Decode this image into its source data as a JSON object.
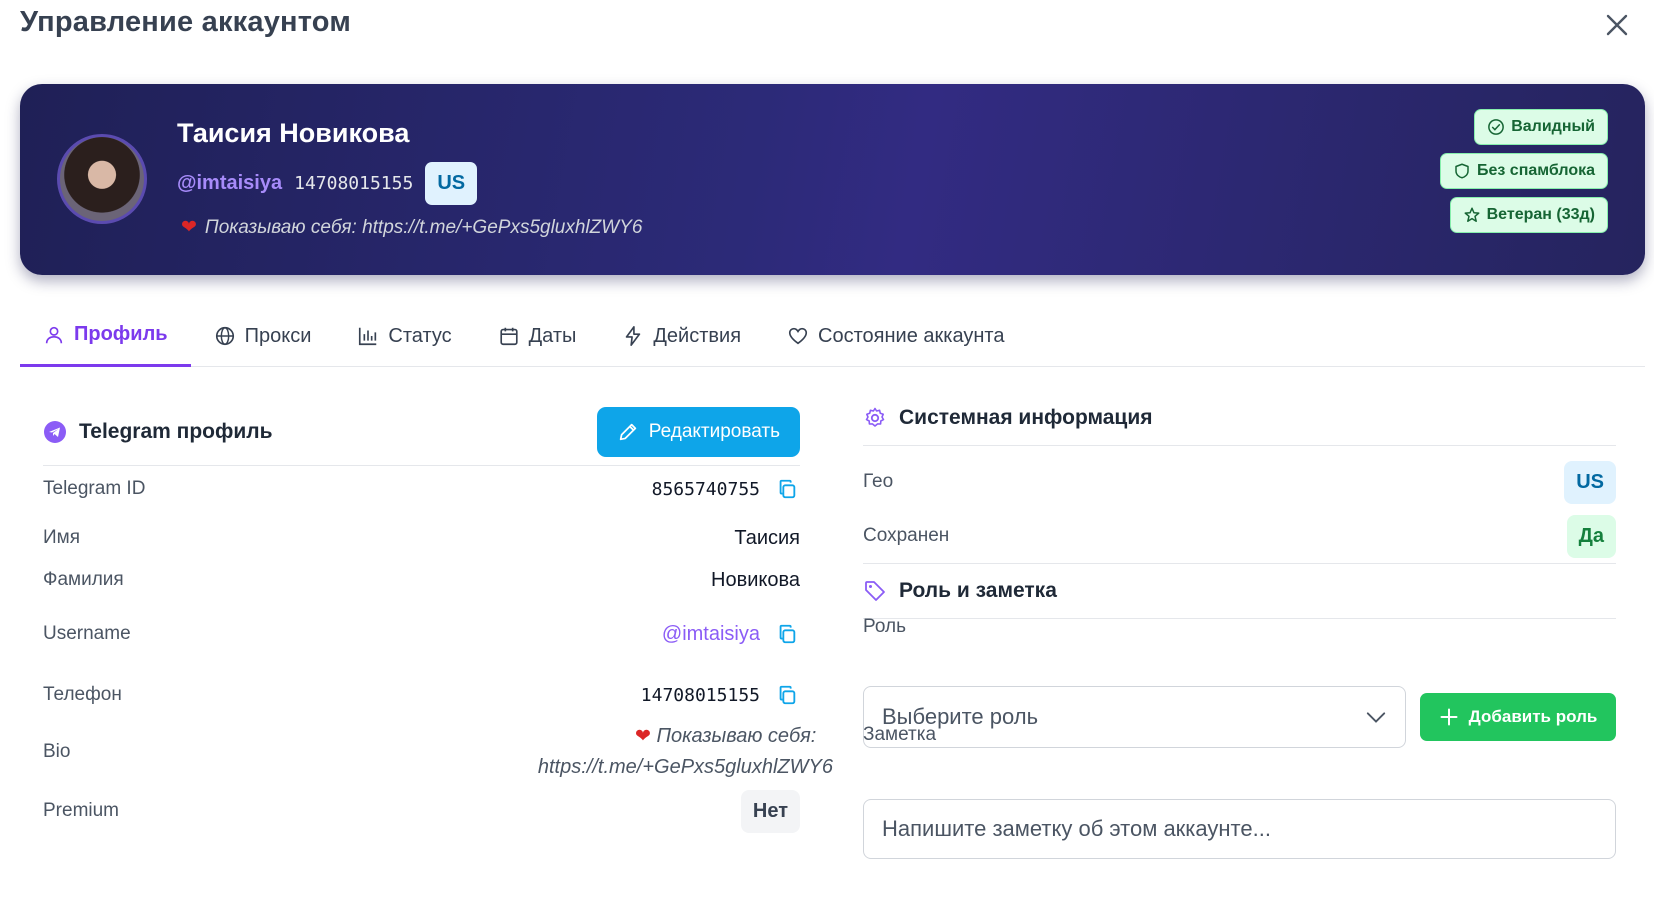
{
  "modal": {
    "title": "Управление аккаунтом"
  },
  "hero": {
    "name": "Таисия Новикова",
    "username": "@imtaisiya",
    "phone": "14708015155",
    "geo": "US",
    "bio": "Показываю себя: https://t.me/+GePxs5gluxhlZWY6",
    "badges": {
      "valid": "Валидный",
      "no_spamblock": "Без спамблока",
      "veteran": "Ветеран (33д)"
    }
  },
  "tabs": [
    {
      "label": "Профиль",
      "icon": "user-icon",
      "active": true
    },
    {
      "label": "Прокси",
      "icon": "globe-icon"
    },
    {
      "label": "Статус",
      "icon": "bar-chart-icon"
    },
    {
      "label": "Даты",
      "icon": "calendar-icon"
    },
    {
      "label": "Действия",
      "icon": "lightning-icon"
    },
    {
      "label": "Состояние аккаунта",
      "icon": "heart-icon"
    }
  ],
  "telegram_profile": {
    "title": "Telegram профиль",
    "edit_label": "Редактировать",
    "fields": {
      "telegram_id": {
        "label": "Telegram ID",
        "value": "8565740755"
      },
      "first_name": {
        "label": "Имя",
        "value": "Таисия"
      },
      "last_name": {
        "label": "Фамилия",
        "value": "Новикова"
      },
      "username": {
        "label": "Username",
        "value": "@imtaisiya"
      },
      "phone": {
        "label": "Телефон",
        "value": "14708015155"
      },
      "bio": {
        "label": "Bio",
        "line1": "Показываю себя:",
        "line2": "https://t.me/+GePxs5gluxhlZWY6"
      },
      "premium": {
        "label": "Premium",
        "value": "Нет"
      }
    }
  },
  "system_info": {
    "title": "Системная информация",
    "geo": {
      "label": "Гео",
      "value": "US"
    },
    "saved": {
      "label": "Сохранен",
      "value": "Да"
    }
  },
  "role_note": {
    "title": "Роль и заметка",
    "role_label": "Роль",
    "role_placeholder": "Выберите роль",
    "add_role_label": "Добавить роль",
    "note_label": "Заметка",
    "note_placeholder": "Напишите заметку об этом аккаунте..."
  },
  "colors": {
    "accent": "#7c3aed",
    "edit_button": "#0ea5e9",
    "add_button": "#22c55e",
    "hero_bg": "#2c2a78"
  }
}
